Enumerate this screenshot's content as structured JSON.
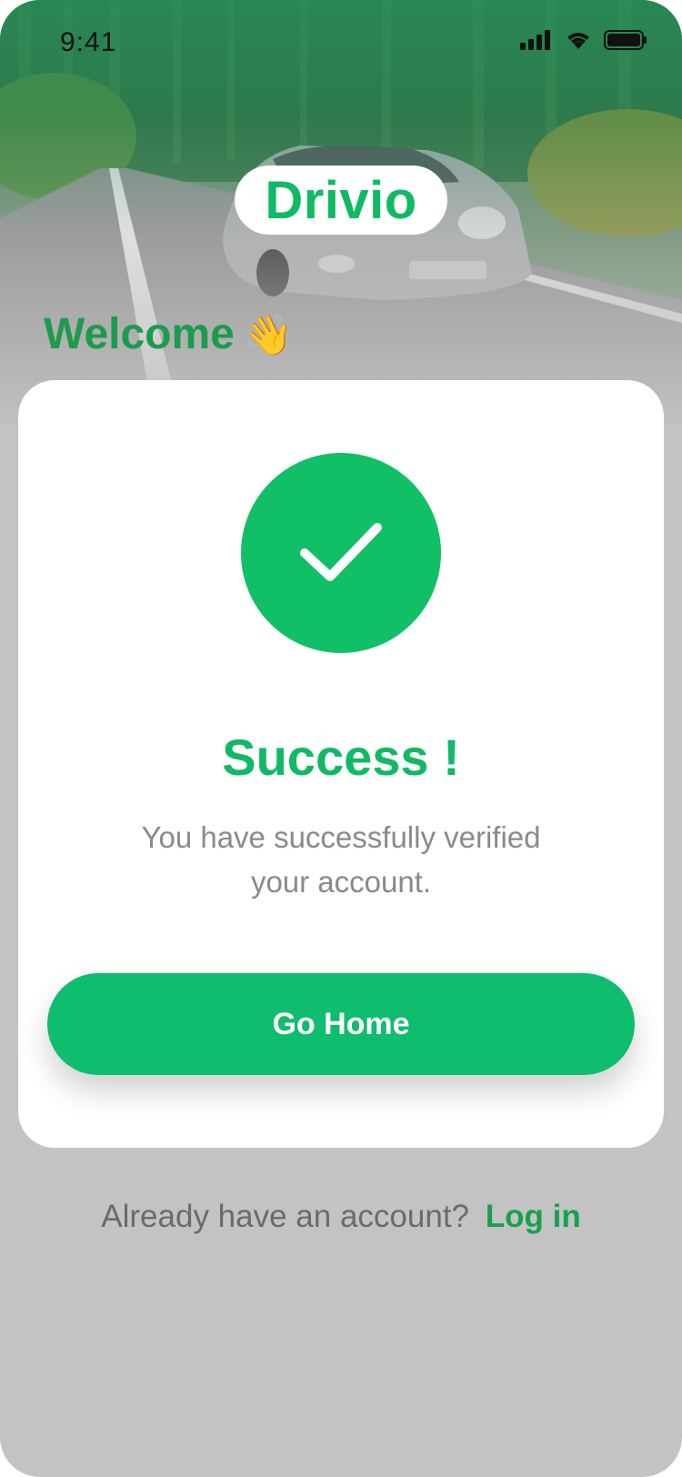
{
  "status_bar": {
    "time": "9:41",
    "icons": [
      "signal-icon",
      "wifi-icon",
      "battery-icon"
    ]
  },
  "brand": {
    "name": "Drivio",
    "color": "#10b964"
  },
  "welcome": {
    "text": "Welcome",
    "emoji": "👋"
  },
  "card": {
    "icon": "checkmark-icon",
    "title": "Success !",
    "message": "You have successfully verified your account.",
    "button_label": "Go Home",
    "accent": "#10bf66"
  },
  "footer": {
    "prompt": "Already have an account?",
    "link_label": "Log in"
  }
}
